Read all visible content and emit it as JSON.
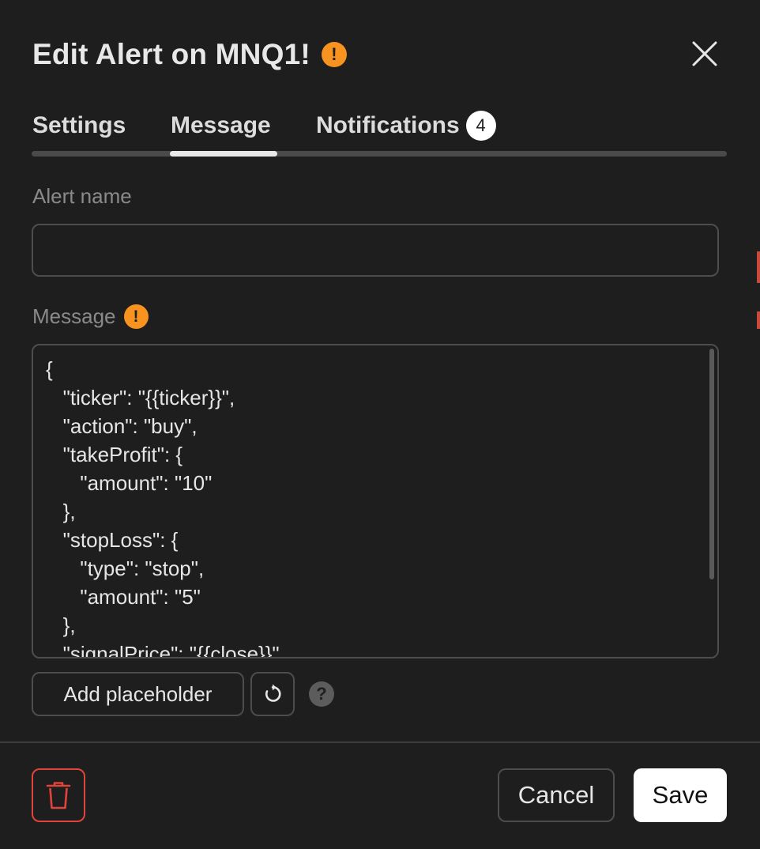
{
  "dialog": {
    "title": "Edit Alert on MNQ1!",
    "warning_glyph": "!"
  },
  "tabs": [
    {
      "label": "Settings"
    },
    {
      "label": "Message",
      "active": true
    },
    {
      "label": "Notifications",
      "badge": "4"
    }
  ],
  "alert_name": {
    "label": "Alert name",
    "value": "",
    "placeholder": ""
  },
  "message": {
    "label": "Message",
    "warning_glyph": "!",
    "value": "{\n   \"ticker\": \"{{ticker}}\",\n   \"action\": \"buy\",\n   \"takeProfit\": {\n      \"amount\": \"10\"\n   },\n   \"stopLoss\": {\n      \"type\": \"stop\",\n      \"amount\": \"5\"\n   },\n   \"signalPrice\": \"{{close}}\""
  },
  "toolbar": {
    "add_placeholder_label": "Add placeholder",
    "help_glyph": "?"
  },
  "footer": {
    "cancel_label": "Cancel",
    "save_label": "Save"
  },
  "icons": {
    "close": "close-icon",
    "reset": "reset-icon",
    "help": "help-icon",
    "delete": "trash-icon",
    "warning": "warning-icon"
  },
  "colors": {
    "background": "#1e1e1e",
    "warning": "#f7931e",
    "danger": "#e0443a",
    "primary_button": "#ffffff"
  }
}
